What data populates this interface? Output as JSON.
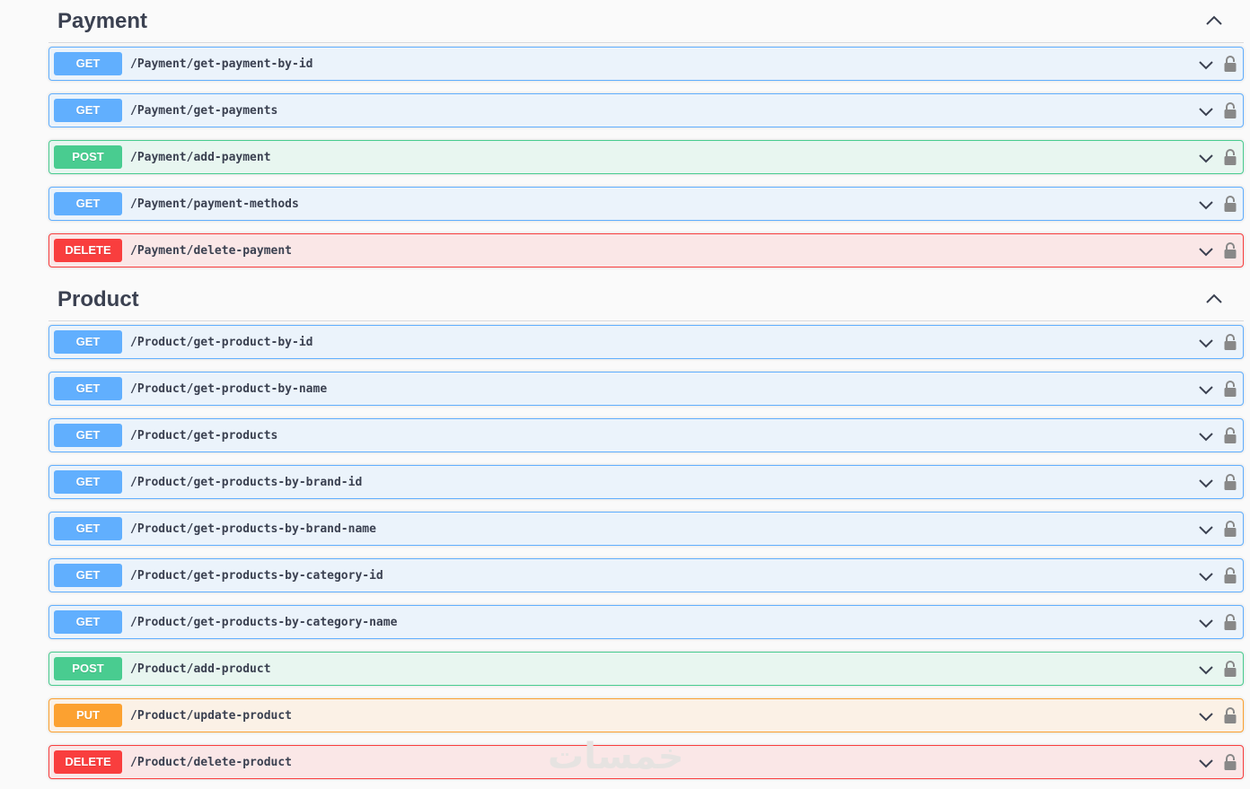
{
  "sections": {
    "payment": {
      "title": "Payment",
      "ops": [
        {
          "method": "GET",
          "path": "/Payment/get-payment-by-id"
        },
        {
          "method": "GET",
          "path": "/Payment/get-payments"
        },
        {
          "method": "POST",
          "path": "/Payment/add-payment"
        },
        {
          "method": "GET",
          "path": "/Payment/payment-methods"
        },
        {
          "method": "DELETE",
          "path": "/Payment/delete-payment"
        }
      ]
    },
    "product": {
      "title": "Product",
      "ops": [
        {
          "method": "GET",
          "path": "/Product/get-product-by-id"
        },
        {
          "method": "GET",
          "path": "/Product/get-product-by-name"
        },
        {
          "method": "GET",
          "path": "/Product/get-products"
        },
        {
          "method": "GET",
          "path": "/Product/get-products-by-brand-id"
        },
        {
          "method": "GET",
          "path": "/Product/get-products-by-brand-name"
        },
        {
          "method": "GET",
          "path": "/Product/get-products-by-category-id"
        },
        {
          "method": "GET",
          "path": "/Product/get-products-by-category-name"
        },
        {
          "method": "POST",
          "path": "/Product/add-product"
        },
        {
          "method": "PUT",
          "path": "/Product/update-product"
        },
        {
          "method": "DELETE",
          "path": "/Product/delete-product"
        }
      ]
    }
  },
  "icons": {
    "section_toggle": "chevron-up-icon",
    "op_toggle": "chevron-down-icon",
    "authorization": "lock-icon"
  },
  "colors": {
    "GET": "#61affe",
    "POST": "#49cc90",
    "PUT": "#fca130",
    "DELETE": "#f93e3e"
  },
  "watermark": "خمسات"
}
